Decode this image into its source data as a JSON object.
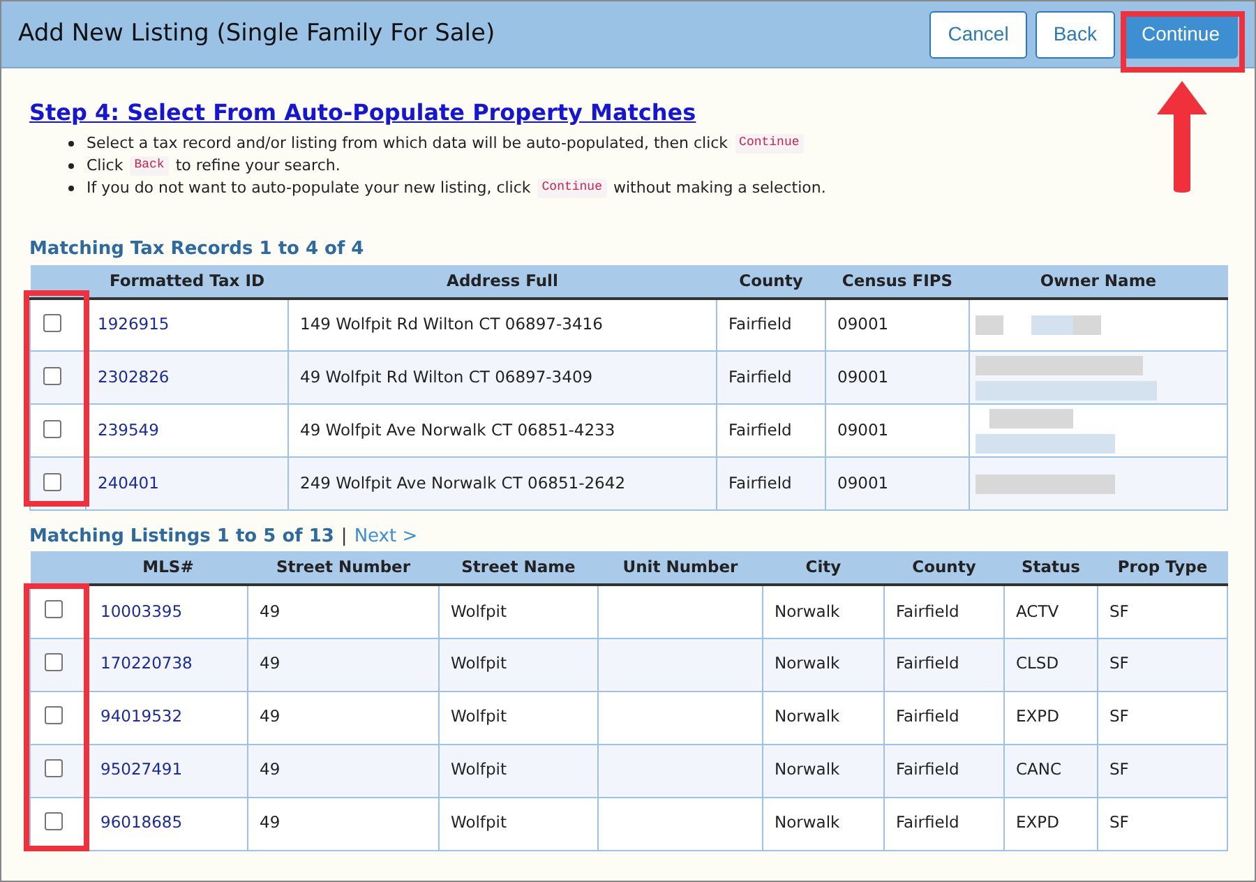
{
  "window": {
    "title": "Add New Listing (Single Family For Sale)"
  },
  "buttons": [
    {
      "label": "Cancel",
      "kind": "outline"
    },
    {
      "label": "Back",
      "kind": "outline"
    },
    {
      "label": "Continue",
      "kind": "primary"
    }
  ],
  "step": {
    "title": "Step 4: Select From Auto-Populate Property Matches",
    "bullets": [
      [
        {
          "kind": "text",
          "text": "Select a tax record and/or listing from which data will be auto-populated, then click"
        },
        {
          "kind": "code",
          "text": "Continue"
        }
      ],
      [
        {
          "kind": "text",
          "text": "Click"
        },
        {
          "kind": "code",
          "text": "Back"
        },
        {
          "kind": "text",
          "text": "to refine your search."
        }
      ],
      [
        {
          "kind": "text",
          "text": "If you do not want to auto-populate your new listing, click"
        },
        {
          "kind": "code",
          "text": "Continue"
        },
        {
          "kind": "text",
          "text": "without making a selection."
        }
      ]
    ]
  },
  "tax_records": {
    "title": "Matching Tax Records 1 to 4 of 4",
    "columns": [
      "Formatted Tax ID",
      "Address Full",
      "County",
      "Census FIPS",
      "Owner Name"
    ],
    "rows": [
      {
        "checked": false,
        "cells": [
          "1926915",
          "149 Wolfpit Rd Wilton CT 06897-3416",
          "Fairfield",
          "09001"
        ]
      },
      {
        "checked": false,
        "cells": [
          "2302826",
          "49 Wolfpit Rd Wilton CT 06897-3409",
          "Fairfield",
          "09001"
        ]
      },
      {
        "checked": false,
        "cells": [
          "239549",
          "49 Wolfpit Ave Norwalk CT 06851-4233",
          "Fairfield",
          "09001"
        ]
      },
      {
        "checked": false,
        "cells": [
          "240401",
          "249 Wolfpit Ave Norwalk CT 06851-2642",
          "Fairfield",
          "09001"
        ]
      }
    ]
  },
  "listings": {
    "title": "Matching Listings 1 to 5 of 13",
    "separator": "|",
    "next_link": "Next >",
    "columns": [
      "MLS#",
      "Street Number",
      "Street Name",
      "Unit Number",
      "City",
      "County",
      "Status",
      "Prop Type"
    ],
    "rows": [
      {
        "checked": false,
        "cells": [
          "10003395",
          "49",
          "Wolfpit",
          "",
          "Norwalk",
          "Fairfield",
          "ACTV",
          "SF"
        ]
      },
      {
        "checked": false,
        "cells": [
          "170220738",
          "49",
          "Wolfpit",
          "",
          "Norwalk",
          "Fairfield",
          "CLSD",
          "SF"
        ]
      },
      {
        "checked": false,
        "cells": [
          "94019532",
          "49",
          "Wolfpit",
          "",
          "Norwalk",
          "Fairfield",
          "EXPD",
          "SF"
        ]
      },
      {
        "checked": false,
        "cells": [
          "95027491",
          "49",
          "Wolfpit",
          "",
          "Norwalk",
          "Fairfield",
          "CANC",
          "SF"
        ]
      },
      {
        "checked": false,
        "cells": [
          "96018685",
          "49",
          "Wolfpit",
          "",
          "Norwalk",
          "Fairfield",
          "EXPD",
          "SF"
        ]
      }
    ]
  }
}
